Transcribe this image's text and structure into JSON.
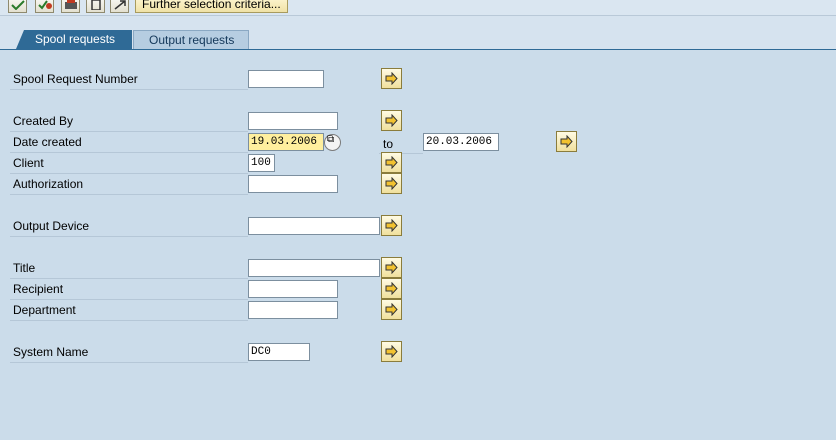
{
  "toolbar": {
    "further_label": "Further selection criteria...",
    "icons": [
      "execute-icon",
      "multi-select-icon",
      "print-icon",
      "delete-icon",
      "enlarge-icon"
    ]
  },
  "tabs": [
    {
      "label": "Spool requests",
      "active": true
    },
    {
      "label": "Output requests",
      "active": false
    }
  ],
  "fields": {
    "spool_request_number": {
      "label": "Spool Request Number",
      "value": ""
    },
    "created_by": {
      "label": "Created By",
      "value": ""
    },
    "date_created": {
      "label": "Date created",
      "from": "19.03.2006",
      "to_label": "to",
      "to": "20.03.2006"
    },
    "client": {
      "label": "Client",
      "value": "100"
    },
    "authorization": {
      "label": "Authorization",
      "value": ""
    },
    "output_device": {
      "label": "Output Device",
      "value": ""
    },
    "title": {
      "label": "Title",
      "value": ""
    },
    "recipient": {
      "label": "Recipient",
      "value": ""
    },
    "department": {
      "label": "Department",
      "value": ""
    },
    "system_name": {
      "label": "System Name",
      "value": "DC0"
    }
  },
  "colors": {
    "active_tab": "#2f6a96",
    "panel": "#cbdcea",
    "highlight_field": "#ffef9e"
  }
}
